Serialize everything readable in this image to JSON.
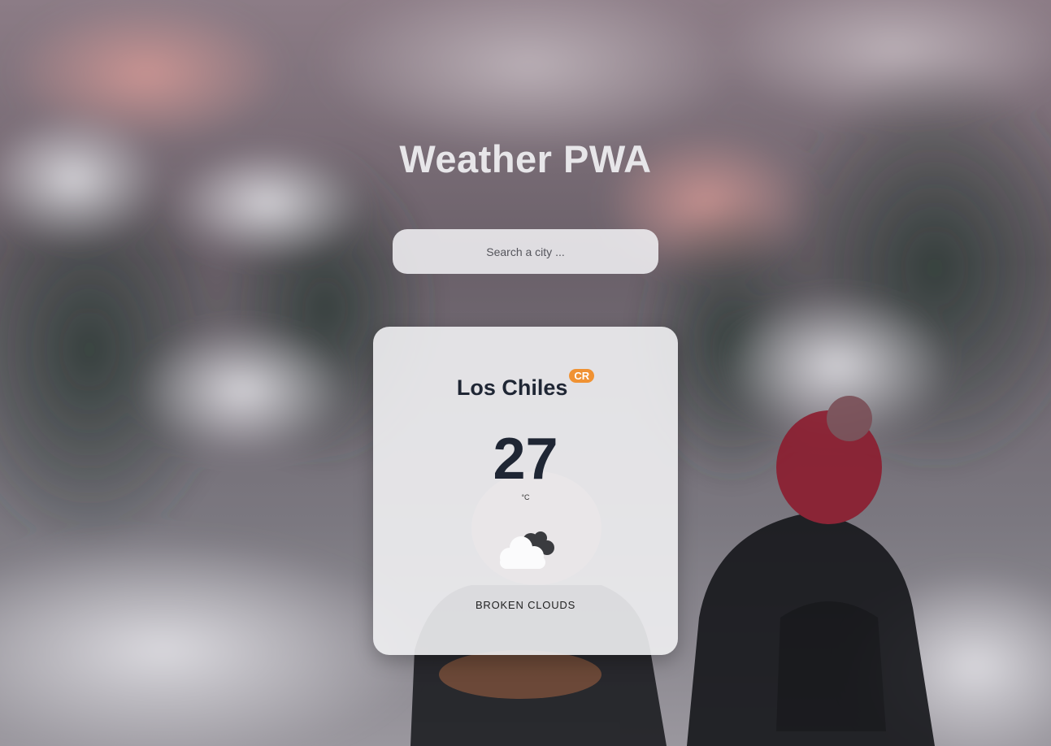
{
  "app": {
    "title": "Weather PWA"
  },
  "search": {
    "placeholder": "Search a city ..."
  },
  "weather": {
    "city": "Los Chiles",
    "country_code": "CR",
    "temperature": "27",
    "unit": "°C",
    "icon": "broken-clouds-icon",
    "description": "BROKEN CLOUDS"
  },
  "colors": {
    "badge": "#f09233",
    "text_dark": "#1f2634",
    "card_bg": "#f0f0f2"
  }
}
